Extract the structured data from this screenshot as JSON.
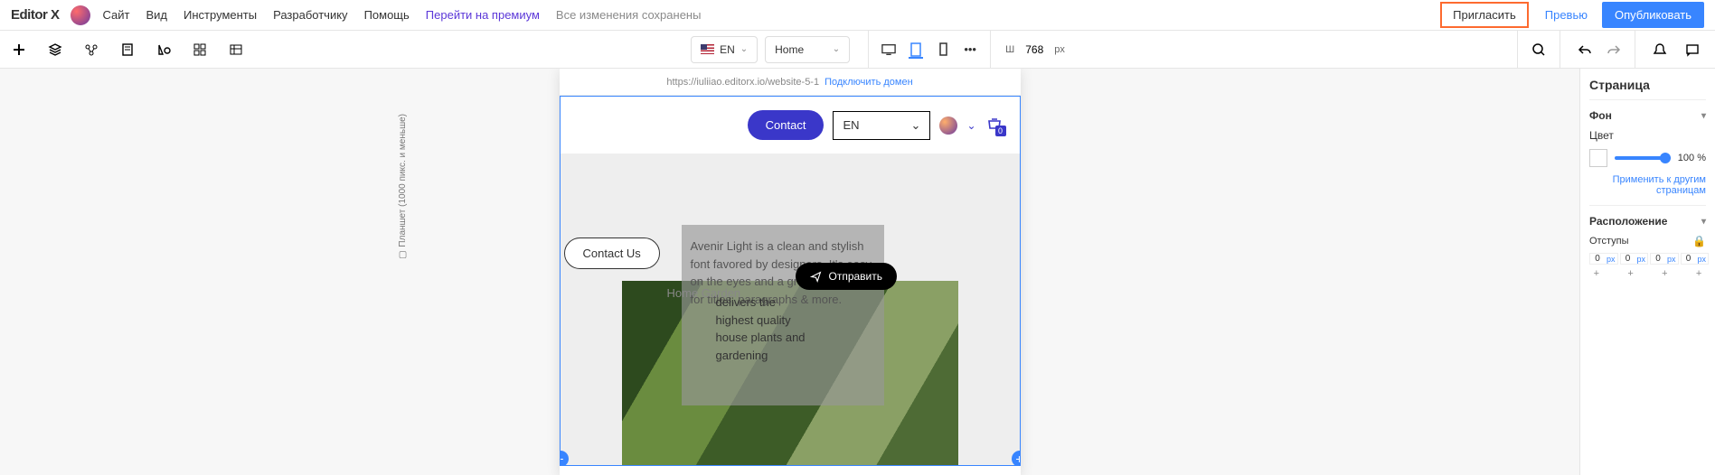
{
  "brand": "Editor X",
  "menu": {
    "site": "Сайт",
    "view": "Вид",
    "tools": "Инструменты",
    "dev": "Разработчику",
    "help": "Помощь",
    "upgrade": "Перейти на премиум",
    "saved": "Все изменения сохранены"
  },
  "actions": {
    "invite": "Пригласить",
    "preview": "Превью",
    "publish": "Опубликовать"
  },
  "toolbar": {
    "lang": "EN",
    "page": "Home",
    "width_label": "Ш",
    "width_value": "768",
    "width_unit": "px"
  },
  "address": {
    "url": "https://iuliiao.editorx.io/website-5-1",
    "connect": "Подключить домен"
  },
  "ruler": {
    "label": "Планшет (1000 пикс. и меньше)"
  },
  "site": {
    "contact_btn": "Contact",
    "lang_dd": "EN",
    "cart_count": "0",
    "contact_us": "Contact Us",
    "home_garden": "Home Garden",
    "para1": "Avenir Light is a clean and stylish font favored by designers. It's easy on the eyes and a great go to font for titles, paragraphs & more.",
    "para2": "delivers the highest quality house plants and gardening",
    "send": "Отправить"
  },
  "panel": {
    "title": "Страница",
    "bg": "Фон",
    "color_label": "Цвет",
    "opacity": "100",
    "opacity_unit": "%",
    "apply": "Применить к другим страницам",
    "layout": "Расположение",
    "padding": "Отступы",
    "pad": [
      {
        "v": "0",
        "u": "px"
      },
      {
        "v": "0",
        "u": "px"
      },
      {
        "v": "0",
        "u": "px"
      },
      {
        "v": "0",
        "u": "px"
      }
    ]
  }
}
